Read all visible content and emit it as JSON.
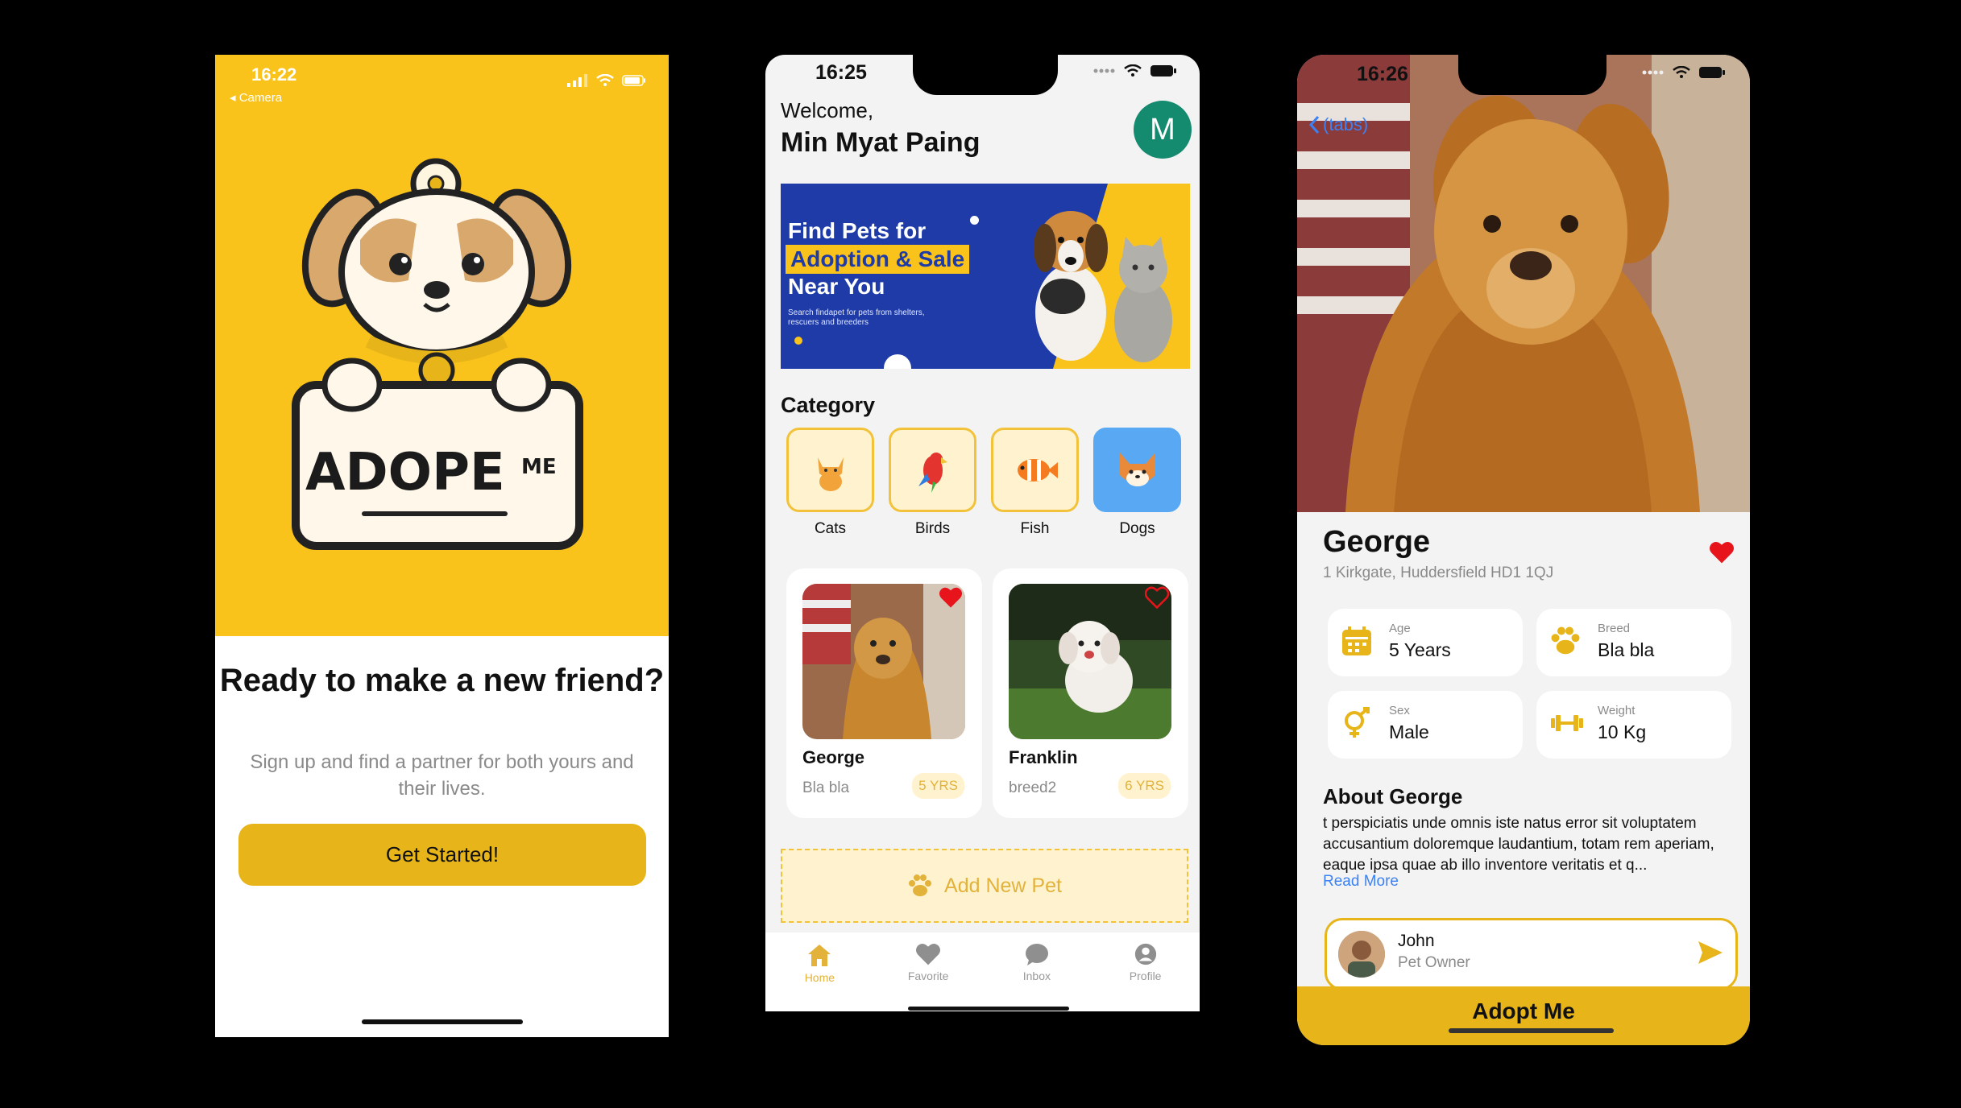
{
  "screen1": {
    "status_time": "16:22",
    "status_back": "◂ Camera",
    "logo_text": "ADOPE",
    "logo_suffix": "ME",
    "title": "Ready to make a new friend?",
    "subtitle": "Sign up and find a partner for both yours and their lives.",
    "cta_label": "Get Started!",
    "colors": {
      "hero": "#FAC31C",
      "cta": "#E7B51A"
    }
  },
  "screen2": {
    "status_time": "16:25",
    "welcome": "Welcome,",
    "user_name": "Min Myat Paing",
    "avatar_letter": "M",
    "banner": {
      "line1": "Find Pets for",
      "line2": "Adoption & Sale",
      "line3": "Near You",
      "small": "Search findapet for pets from shelters, rescuers and breeders"
    },
    "category_title": "Category",
    "categories": [
      {
        "label": "Cats",
        "icon": "cat-icon",
        "selected": false
      },
      {
        "label": "Birds",
        "icon": "parrot-icon",
        "selected": false
      },
      {
        "label": "Fish",
        "icon": "fish-icon",
        "selected": false
      },
      {
        "label": "Dogs",
        "icon": "dog-icon",
        "selected": true
      }
    ],
    "pets": [
      {
        "name": "George",
        "breed": "Bla bla",
        "age": "5 YRS",
        "favorite": true
      },
      {
        "name": "Franklin",
        "breed": "breed2",
        "age": "6 YRS",
        "favorite": false
      }
    ],
    "add_pet_label": "Add New Pet",
    "tabs": [
      {
        "label": "Home",
        "icon": "home-icon",
        "active": true
      },
      {
        "label": "Favorite",
        "icon": "heart-icon",
        "active": false
      },
      {
        "label": "Inbox",
        "icon": "chat-icon",
        "active": false
      },
      {
        "label": "Profile",
        "icon": "profile-icon",
        "active": false
      }
    ],
    "colors": {
      "accent": "#E2B23A",
      "banner": "#1E3BA8",
      "avatar": "#148A6F",
      "selected_category": "#58A8F4"
    }
  },
  "screen3": {
    "status_time": "16:26",
    "back_label": "(tabs)",
    "pet_name": "George",
    "address": "1 Kirkgate, Huddersfield HD1 1QJ",
    "info": [
      {
        "label": "Age",
        "value": "5 Years",
        "icon": "calendar-icon"
      },
      {
        "label": "Breed",
        "value": "Bla bla",
        "icon": "paw-icon"
      },
      {
        "label": "Sex",
        "value": "Male",
        "icon": "gender-icon"
      },
      {
        "label": "Weight",
        "value": "10 Kg",
        "icon": "dumbbell-icon"
      }
    ],
    "about_title": "About George",
    "about_text": "t perspiciatis unde omnis iste natus error sit voluptatem accusantium doloremque laudantium, totam rem aperiam, eaque ipsa quae ab illo inventore veritatis et q...",
    "read_more": "Read More",
    "owner": {
      "name": "John",
      "role": "Pet Owner"
    },
    "adopt_label": "Adopt Me",
    "colors": {
      "accent": "#E7B51A",
      "heart": "#E8141C",
      "link": "#3B82F6"
    }
  }
}
